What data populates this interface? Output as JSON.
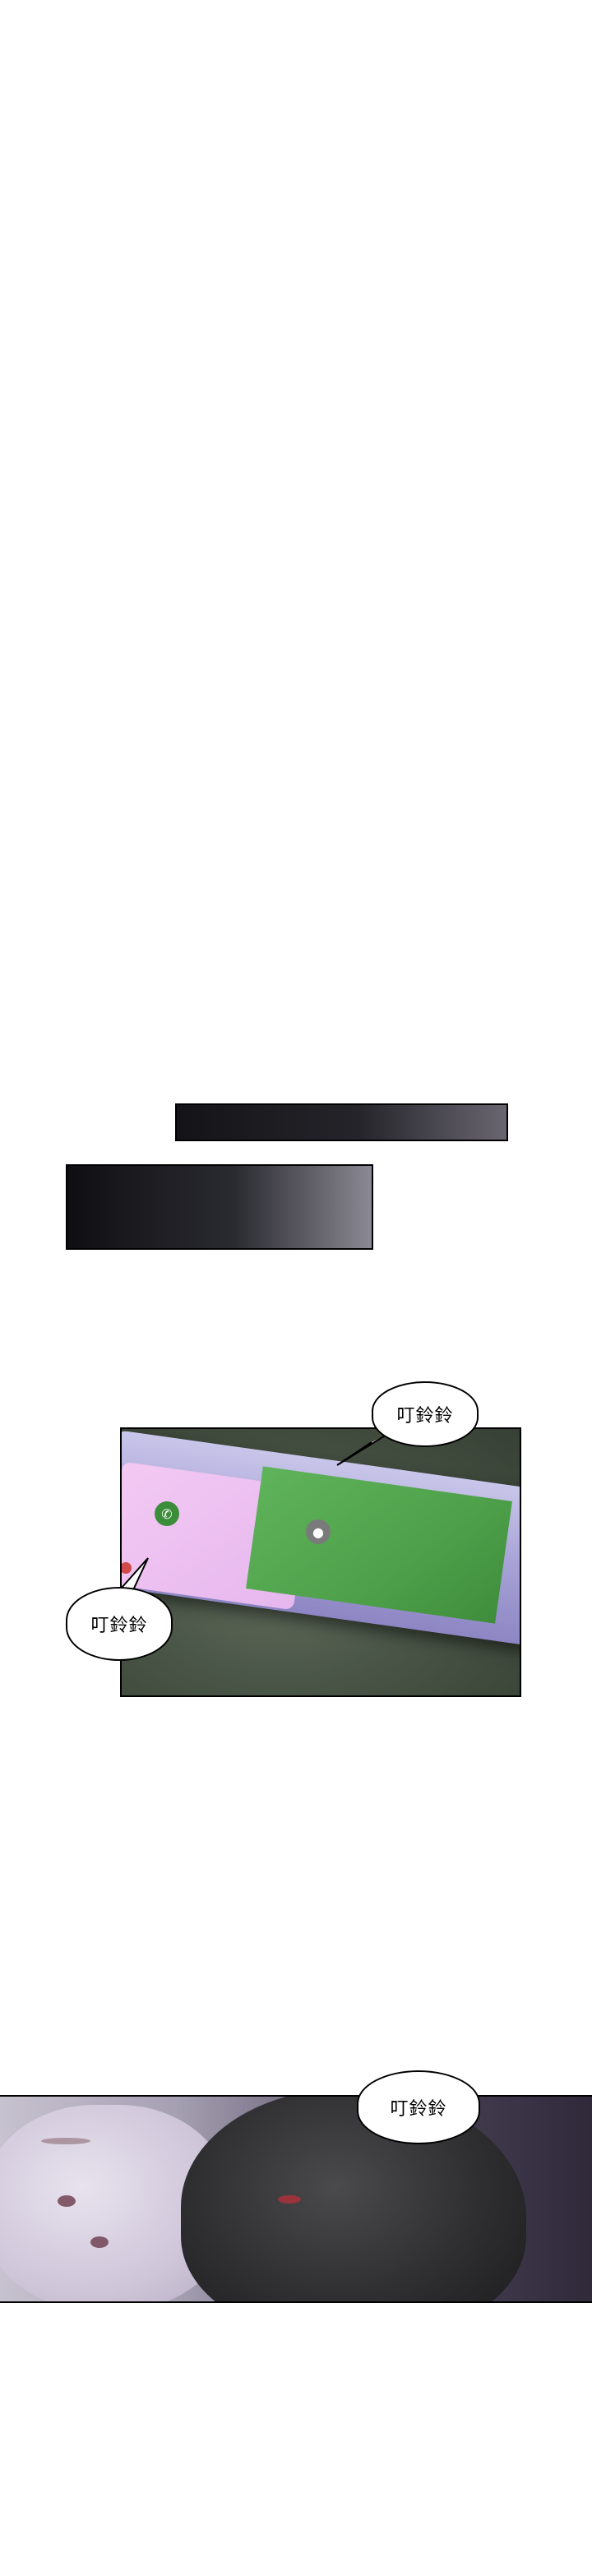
{
  "sfx": {
    "ring_1": "叮鈴鈴",
    "ring_2": "叮鈴鈴",
    "ring_3": "叮鈴鈴"
  }
}
